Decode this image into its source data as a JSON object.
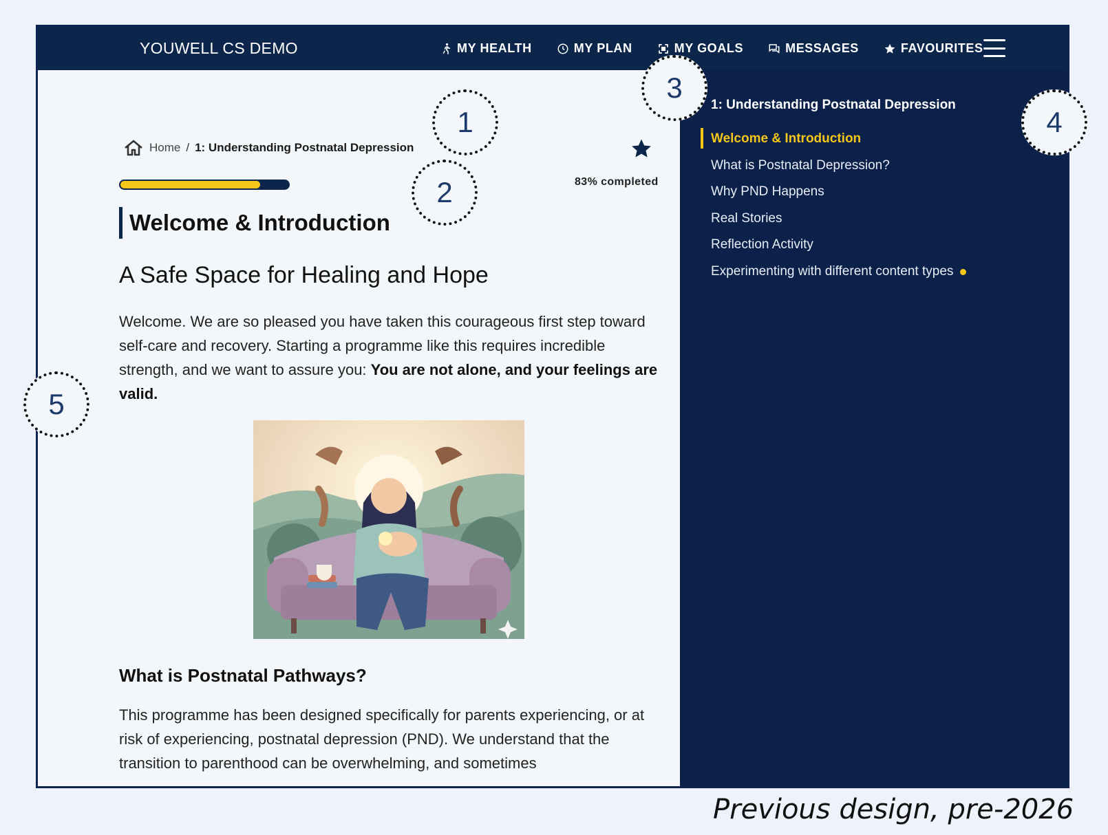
{
  "topnav": {
    "brand": "YOUWELL CS DEMO",
    "items": [
      {
        "label": "MY HEALTH",
        "icon": "walking-person-icon"
      },
      {
        "label": "MY PLAN",
        "icon": "clock-icon"
      },
      {
        "label": "MY GOALS",
        "icon": "goals-icon"
      },
      {
        "label": "MESSAGES",
        "icon": "chat-icon"
      },
      {
        "label": "FAVOURITES",
        "icon": "star-icon"
      }
    ],
    "menu_icon": "hamburger-menu-icon"
  },
  "breadcrumb": {
    "home": "Home",
    "separator": "/",
    "current": "1: Understanding Postnatal Depression"
  },
  "progress": {
    "percent": 83,
    "label": "83% completed"
  },
  "content": {
    "title": "Welcome & Introduction",
    "subtitle": "A Safe Space for Healing and Hope",
    "para1_plain": "Welcome. We are so pleased you have taken this courageous first step toward self-care and recovery. Starting a programme like this requires incredible strength, and we want to assure you: ",
    "para1_bold": "You are not alone, and your feelings are valid.",
    "section_heading": "What is Postnatal Pathways?",
    "para2": "This programme has been designed specifically for parents experiencing, or at risk of experiencing, postnatal depression (PND). We understand that the transition to parenthood can be overwhelming, and sometimes"
  },
  "sidebar": {
    "title": "1: Understanding Postnatal Depression",
    "items": [
      {
        "label": "Welcome & Introduction",
        "active": true
      },
      {
        "label": "What is Postnatal Depression?",
        "active": false
      },
      {
        "label": "Why PND Happens",
        "active": false
      },
      {
        "label": "Real Stories",
        "active": false
      },
      {
        "label": "Reflection Activity",
        "active": false
      },
      {
        "label": "Experimenting with different content types",
        "active": false
      }
    ]
  },
  "callouts": [
    "1",
    "2",
    "3",
    "4",
    "5"
  ],
  "caption": "Previous design, pre-2026",
  "colors": {
    "navy": "#0b254b",
    "accent_yellow": "#f5c518",
    "page_bg": "#f3f7f9"
  }
}
